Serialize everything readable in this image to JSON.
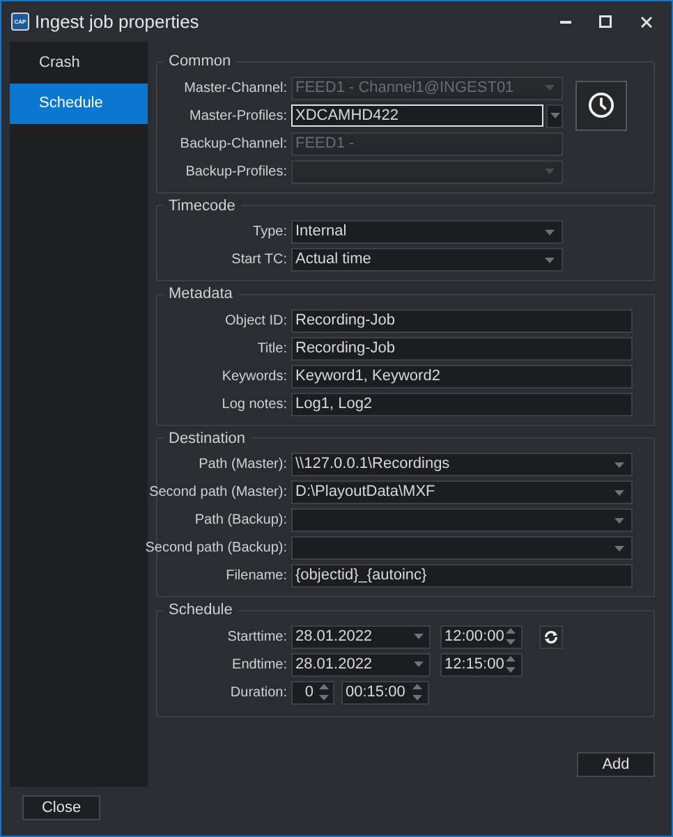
{
  "window": {
    "app_icon_text": "CAP",
    "title": "Ingest job properties"
  },
  "sidebar": {
    "items": [
      {
        "label": "Crash",
        "selected": false
      },
      {
        "label": "Schedule",
        "selected": true
      }
    ]
  },
  "groups": [
    {
      "title": "Common",
      "clock_button": true,
      "fields": [
        {
          "label": "Master-Channel:",
          "kind": "combo",
          "value": "FEED1 - Channel1@INGEST01",
          "disabled": true,
          "focused": false
        },
        {
          "label": "Master-Profiles:",
          "kind": "combo",
          "value": "XDCAMHD422",
          "disabled": false,
          "focused": true
        },
        {
          "label": "Backup-Channel:",
          "kind": "text",
          "value": "FEED1 -",
          "disabled": true,
          "focused": false
        },
        {
          "label": "Backup-Profiles:",
          "kind": "combo",
          "disabled": true,
          "focused": false
        }
      ]
    },
    {
      "title": "Timecode",
      "clock_button": false,
      "fields": [
        {
          "label": "Type:",
          "kind": "combo",
          "value": "Internal",
          "disabled": false,
          "focused": false
        },
        {
          "label": "Start TC:",
          "kind": "combo",
          "value": "Actual time",
          "disabled": false,
          "focused": false
        }
      ]
    },
    {
      "title": "Metadata",
      "clock_button": false,
      "fields": [
        {
          "label": "Object ID:",
          "kind": "text",
          "value": "Recording-Job",
          "disabled": false,
          "focused": false
        },
        {
          "label": "Title:",
          "kind": "text",
          "value": "Recording-Job",
          "disabled": false,
          "focused": false
        },
        {
          "label": "Keywords:",
          "kind": "text",
          "value": "Keyword1, Keyword2",
          "disabled": false,
          "focused": false
        },
        {
          "label": "Log notes:",
          "kind": "text",
          "value": "Log1, Log2",
          "disabled": false,
          "focused": false
        }
      ]
    },
    {
      "title": "Destination",
      "clock_button": false,
      "fields": [
        {
          "label": "Path (Master):",
          "kind": "combo",
          "value": "\\\\127.0.0.1\\Recordings",
          "disabled": false,
          "focused": false
        },
        {
          "label": "Second path (Master):",
          "kind": "combo",
          "value": "D:\\PlayoutData\\MXF",
          "disabled": false,
          "focused": false
        },
        {
          "label": "Path (Backup):",
          "kind": "combo",
          "disabled": false,
          "focused": false
        },
        {
          "label": "Second path (Backup):",
          "kind": "combo",
          "disabled": false,
          "focused": false
        },
        {
          "label": "Filename:",
          "kind": "text",
          "value": "{objectid}_{autoinc}",
          "disabled": false,
          "focused": false
        }
      ]
    }
  ],
  "schedule": {
    "title": "Schedule",
    "rows": [
      {
        "label": "Starttime:",
        "date": "28.01.2022",
        "time": "12:00:00",
        "refresh_button": true
      },
      {
        "label": "Endtime:",
        "date": "28.01.2022",
        "time": "12:15:00",
        "refresh_button": false
      }
    ],
    "duration": {
      "label": "Duration:",
      "days": "0",
      "time": "00:15:00"
    }
  },
  "buttons": {
    "add": "Add",
    "close": "Close"
  }
}
